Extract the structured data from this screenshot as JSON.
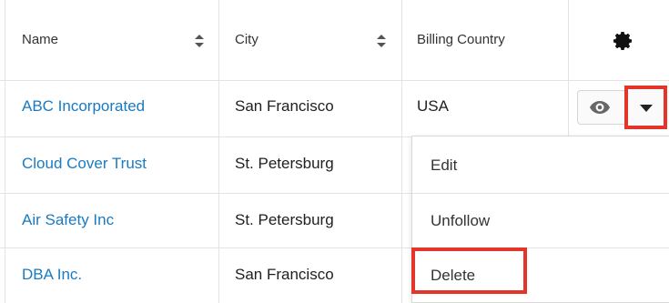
{
  "table": {
    "columns": [
      {
        "label": "Name",
        "sortable": true
      },
      {
        "label": "City",
        "sortable": true
      },
      {
        "label": "Billing Country",
        "sortable": false
      }
    ],
    "settings_icon": "gear-icon",
    "rows": [
      {
        "name": "ABC Incorporated",
        "city": "San Francisco",
        "country": "USA"
      },
      {
        "name": "Cloud Cover Trust",
        "city": "St. Petersburg",
        "country": ""
      },
      {
        "name": "Air Safety Inc",
        "city": "St. Petersburg",
        "country": ""
      },
      {
        "name": "DBA Inc.",
        "city": "San Francisco",
        "country": ""
      }
    ]
  },
  "row_actions": {
    "preview_icon": "eye-icon",
    "toggle_icon": "caret-down-icon"
  },
  "dropdown_menu": {
    "items": [
      {
        "label": "Edit"
      },
      {
        "label": "Unfollow"
      },
      {
        "label": "Delete"
      }
    ]
  },
  "colors": {
    "link": "#1a7ac1",
    "highlight": "#e4352a",
    "grid": "#e3e3e3"
  }
}
